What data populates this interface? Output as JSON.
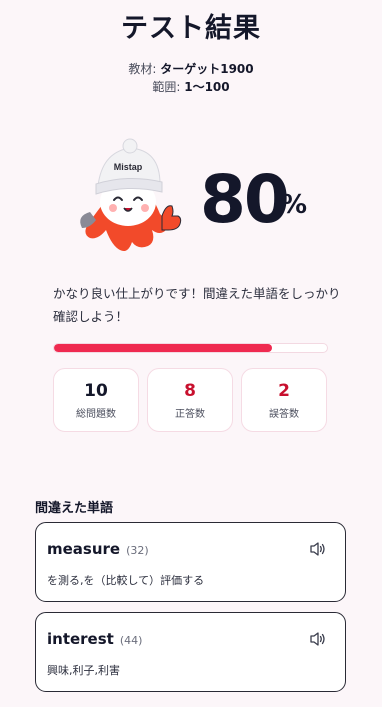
{
  "header": {
    "title": "テスト結果"
  },
  "meta": {
    "material_label": "教材:",
    "material_value": "ターゲット1900",
    "range_label": "範囲:",
    "range_value": "1〜100"
  },
  "mascot": {
    "brand": "Mistap"
  },
  "result": {
    "score": "80",
    "unit": "%",
    "progress_fraction": 0.8,
    "message": "かなり良い仕上がりです！間違えた単語をしっかり確認しよう！"
  },
  "stats": [
    {
      "value": "10",
      "label": "総問題数",
      "color": "#14172a"
    },
    {
      "value": "8",
      "label": "正答数",
      "color": "#c8102e"
    },
    {
      "value": "2",
      "label": "誤答数",
      "color": "#c8102e"
    }
  ],
  "mistakes": {
    "title": "間違えた単語",
    "items": [
      {
        "word": "measure",
        "count": "(32)",
        "meaning": "を測る,を（比較して）評価する",
        "icon": "speaker-icon"
      },
      {
        "word": "interest",
        "count": "(44)",
        "meaning": "興味,利子,利害",
        "icon": "speaker-icon"
      }
    ]
  },
  "colors": {
    "accent": "#ef2a50",
    "background": "#fcf6f9"
  }
}
